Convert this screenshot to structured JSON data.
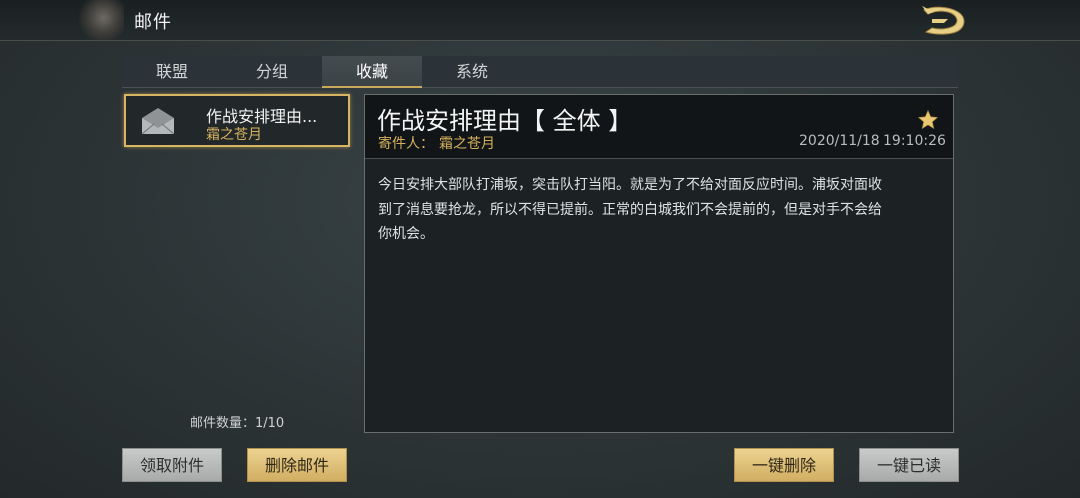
{
  "header": {
    "title": "邮件"
  },
  "tabs": [
    {
      "label": "联盟"
    },
    {
      "label": "分组"
    },
    {
      "label": "收藏",
      "active": true
    },
    {
      "label": "系统"
    }
  ],
  "mail_list": {
    "items": [
      {
        "title": "作战安排理由...",
        "sender": "霜之苍月",
        "selected": true
      }
    ],
    "count_label": "邮件数量：1/10"
  },
  "detail": {
    "title": "作战安排理由【 全体 】",
    "sender_label": "寄件人：",
    "sender_name": "霜之苍月",
    "date": "2020/11/18",
    "time": "19:10:26",
    "starred": true,
    "body_lines": [
      "今日安排大部队打浦坂，突击队打当阳。就是为了不给对面反应时间。浦坂对面收",
      "到了消息要抢龙，所以不得已提前。正常的白城我们不会提前的，但是对手不会给",
      "你机会。"
    ]
  },
  "buttons": {
    "claim_attachments": "领取附件",
    "delete_mail": "删除邮件",
    "delete_all": "一键删除",
    "read_all": "一键已读"
  },
  "colors": {
    "accent_gold": "#d6b25e",
    "selected_border": "#d8b561",
    "gold_button": "#ddbd73",
    "gray_button": "#b9bbba"
  }
}
